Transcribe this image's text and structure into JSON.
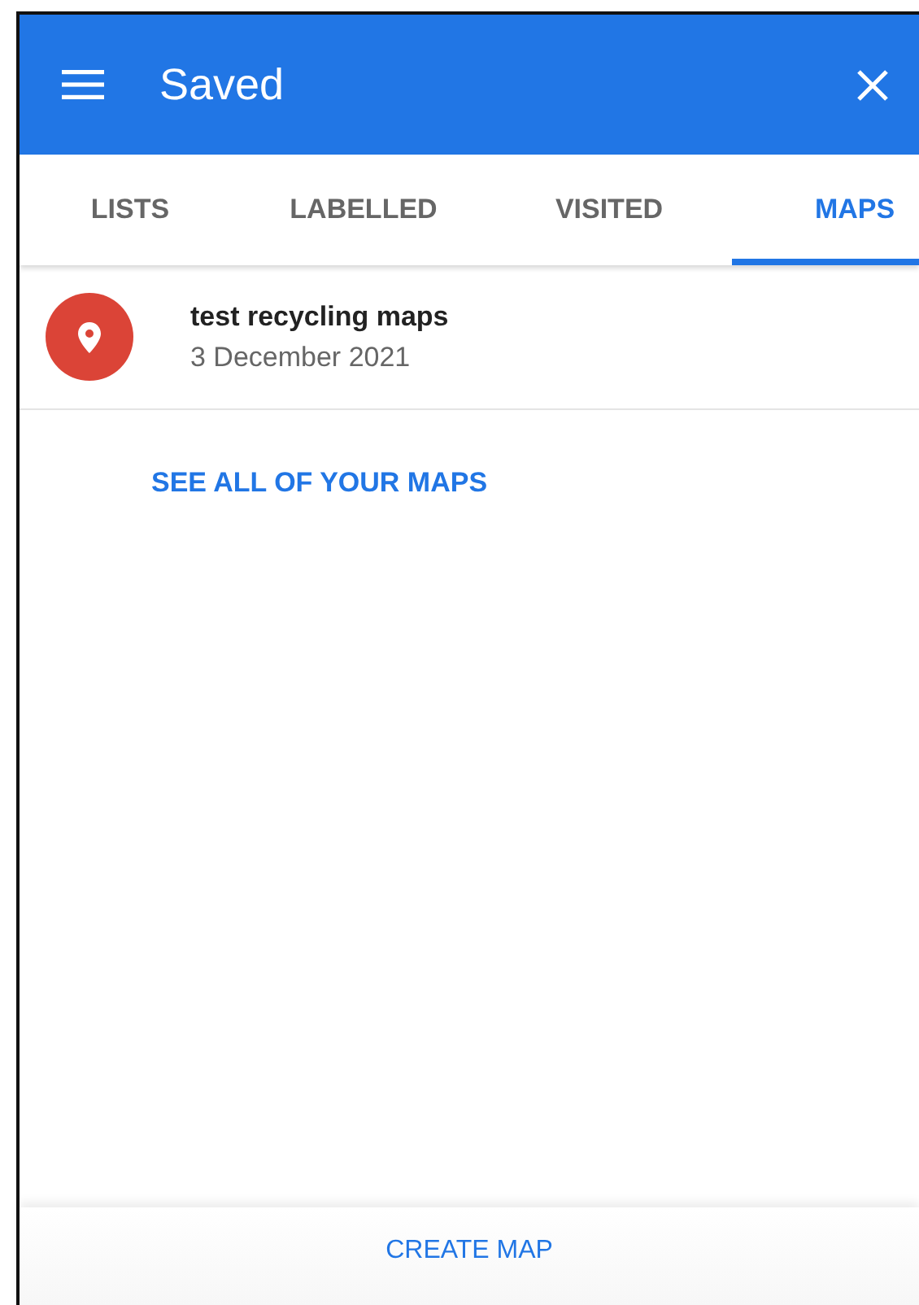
{
  "header": {
    "title": "Saved"
  },
  "tabs": [
    {
      "label": "LISTS",
      "selected": false
    },
    {
      "label": "LABELLED",
      "selected": false
    },
    {
      "label": "VISITED",
      "selected": false
    },
    {
      "label": "MAPS",
      "selected": true
    }
  ],
  "maps": [
    {
      "title": "test recycling maps",
      "date": "3 December 2021"
    }
  ],
  "see_all_link": "SEE ALL OF YOUR MAPS",
  "bottom_button": "CREATE MAP"
}
